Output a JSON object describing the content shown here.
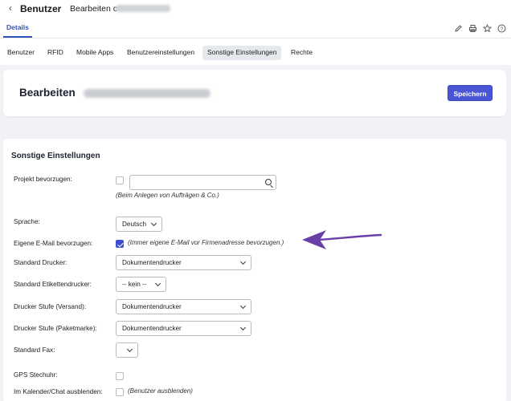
{
  "header": {
    "back_icon": "chevron-left-icon",
    "title_strong": "Benutzer",
    "title_rest": "Bearbeiten c"
  },
  "subtabs": {
    "details": "Details"
  },
  "actions": [
    "pencil-icon",
    "printer-icon",
    "star-icon",
    "help-icon"
  ],
  "tabs": [
    {
      "label": "Benutzer",
      "active": false
    },
    {
      "label": "RFID",
      "active": false
    },
    {
      "label": "Mobile Apps",
      "active": false
    },
    {
      "label": "Benutzereinstellungen",
      "active": false
    },
    {
      "label": "Sonstige Einstellungen",
      "active": true
    },
    {
      "label": "Rechte",
      "active": false
    }
  ],
  "card": {
    "title": "Bearbeiten",
    "save_label": "Speichern"
  },
  "section": {
    "title": "Sonstige Einstellungen",
    "projekt_label": "Projekt bevorzugen:",
    "projekt_checked": false,
    "projekt_search_value": "",
    "projekt_hint": "(Beim Anlegen von Aufträgen & Co.)",
    "sprache_label": "Sprache:",
    "sprache_value": "Deutsch",
    "email_label": "Eigene E-Mail bevorzugen:",
    "email_checked": true,
    "email_hint": "(Immer eigene E-Mail vor Firmenadresse bevorzugen.)",
    "drucker_label": "Standard Drucker:",
    "drucker_value": "Dokumentendrucker",
    "etikett_label": "Standard Etikettendrucker:",
    "etikett_value": "-- kein --",
    "stufe_versand_label": "Drucker Stufe (Versand):",
    "stufe_versand_value": "Dokumentendrucker",
    "stufe_paket_label": "Drucker Stufe (Paketmarke):",
    "stufe_paket_value": "Dokumentendrucker",
    "fax_label": "Standard Fax:",
    "fax_value": "",
    "gps_label": "GPS Stechuhr:",
    "gps_checked": false,
    "kalender_label": "Im Kalender/Chat ausblenden:",
    "kalender_checked": false,
    "kalender_hint": "(Benutzer ausblenden)"
  },
  "colors": {
    "accent": "#4a55d6",
    "arrow": "#6b3fa8",
    "tab_active_bg": "#e5e9ee"
  }
}
